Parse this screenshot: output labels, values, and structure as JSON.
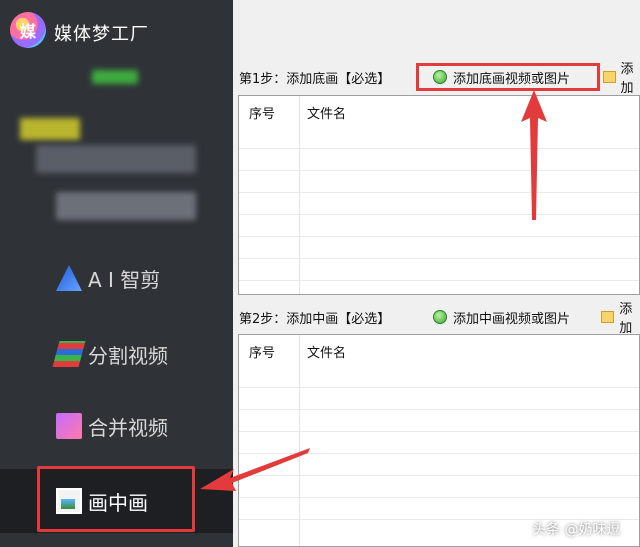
{
  "app": {
    "title": "媒体梦工厂",
    "logo_text": "媒"
  },
  "sidebar": {
    "items": [
      {
        "label": "A I 智剪",
        "icon": "ai-cut-icon"
      },
      {
        "label": "分割视频",
        "icon": "split-video-icon"
      },
      {
        "label": "合并视频",
        "icon": "merge-video-icon"
      },
      {
        "label": "画中画",
        "icon": "picture-in-picture-icon",
        "active": true
      }
    ]
  },
  "step1": {
    "label": "第1步：添加底画【必选】",
    "add_button": "添加底画视频或图片",
    "extra_button": "添加"
  },
  "step2": {
    "label": "第2步：添加中画【必选】",
    "add_button": "添加中画视频或图片",
    "extra_button": "添加"
  },
  "table": {
    "col_index": "序号",
    "col_filename": "文件名"
  },
  "watermark": "头条 @奶味逗",
  "colors": {
    "sidebar_bg": "#2f3338",
    "highlight": "#e33b3b",
    "panel_bg": "#f0f0f0"
  }
}
